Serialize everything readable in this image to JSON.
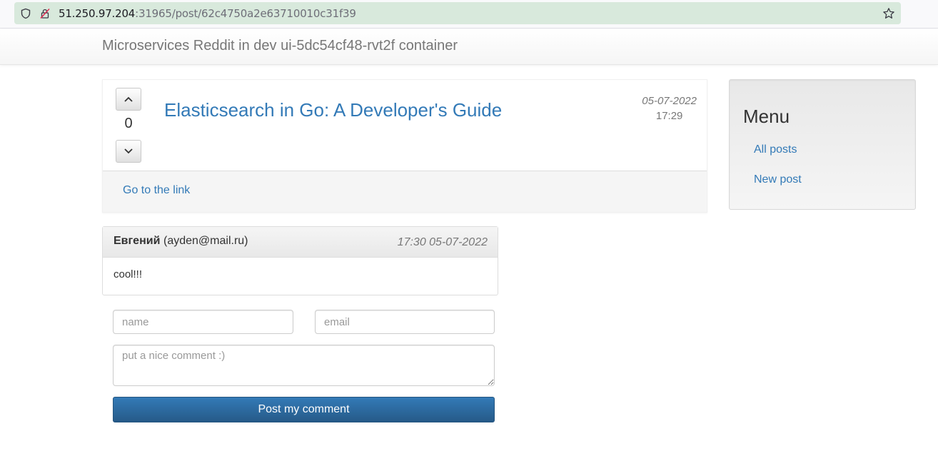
{
  "browser": {
    "url_host": "51.250.97.204",
    "url_path": ":31965/post/62c4750a2e63710010c31f39"
  },
  "navbar": {
    "brand": "Microservices Reddit in dev ui-5dc54cf48-rvt2f container"
  },
  "post": {
    "votes": "0",
    "title": "Elasticsearch in Go: A Developer's Guide",
    "date": "05-07-2022",
    "time": "17:29",
    "link_label": "Go to the link"
  },
  "sidebar": {
    "title": "Menu",
    "items": [
      {
        "label": "All posts"
      },
      {
        "label": "New post"
      }
    ]
  },
  "comments": [
    {
      "author": "Евгений",
      "email": "(ayden@mail.ru)",
      "timestamp": "17:30 05-07-2022",
      "body": "cool!!!"
    }
  ],
  "form": {
    "name_placeholder": "name",
    "email_placeholder": "email",
    "comment_placeholder": "put a nice comment :)",
    "submit_label": "Post my comment"
  }
}
